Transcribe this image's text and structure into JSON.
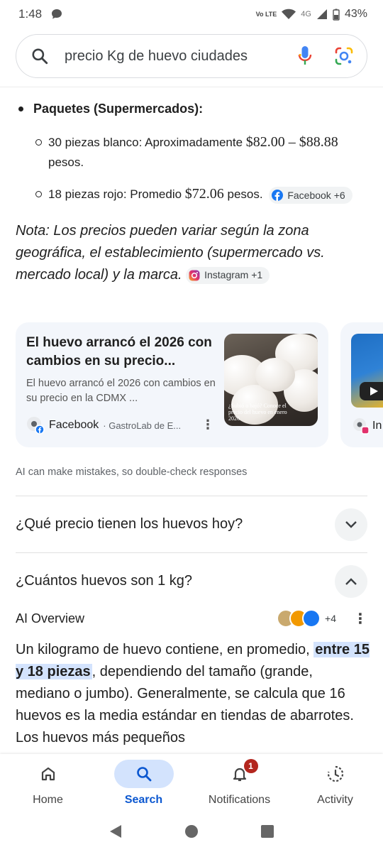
{
  "status_bar": {
    "time": "1:48",
    "volte": "Vo LTE",
    "network": "4G",
    "battery": "43%"
  },
  "search": {
    "query": "precio Kg de huevo ciudades"
  },
  "content": {
    "bullet_title": "Paquetes (Supermercados):",
    "item1_label": "30 piezas blanco: Aproximadamente ",
    "item1_price": "$82.00 – $88.88",
    "item1_unit": "pesos.",
    "item2_label": "18 piezas rojo: Promedio ",
    "item2_price": "$72.06",
    "item2_unit": " pesos.",
    "chip1": "Facebook +6",
    "nota": "Nota: Los precios pueden variar según la zona geográfica, el establecimiento (supermercado vs. mercado local) y la marca.",
    "chip2": "Instagram +1"
  },
  "card": {
    "title": "El huevo arrancó el 2026 con cambios en su precio...",
    "snippet": "El huevo arrancó el 2026 con cambios en su precio en la CDMX ...",
    "source": "Facebook",
    "source_sub": "· GastroLab de E...",
    "image_caption": "¿Subió o bajó? Conoce el precio del huevo en enero 2026",
    "next_source": "In"
  },
  "disclaimer": "AI can make mistakes, so double-check responses",
  "questions": [
    {
      "text": "¿Qué precio tienen los huevos hoy?"
    },
    {
      "text": "¿Cuántos huevos son 1 kg?"
    }
  ],
  "ai_overview": {
    "label": "AI Overview",
    "more_sources": "+4",
    "text_before": "Un kilogramo de huevo contiene, en promedio, ",
    "highlight": "entre 15 y 18 piezas",
    "text_after": ", dependiendo del tamaño (grande, mediano o jumbo). Generalmente, se calcula que 16 huevos es la media estándar en tiendas de abarrotes. Los huevos más pequeños"
  },
  "bottom_nav": {
    "home": "Home",
    "search": "Search",
    "notifications": "Notifications",
    "notifications_badge": "1",
    "activity": "Activity"
  },
  "colors": {
    "accent": "#0b57d0",
    "highlight": "#d3e3fd",
    "badge": "#b3261e"
  }
}
